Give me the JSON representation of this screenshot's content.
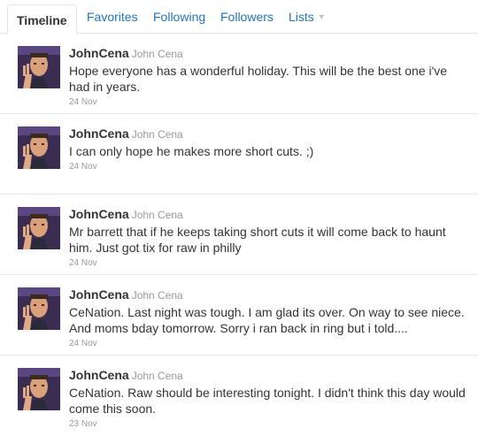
{
  "tabs": [
    {
      "label": "Timeline"
    },
    {
      "label": "Favorites"
    },
    {
      "label": "Following"
    },
    {
      "label": "Followers"
    },
    {
      "label": "Lists"
    }
  ],
  "tweets": [
    {
      "screen_name": "JohnCena",
      "full_name": "John Cena",
      "text": "Hope everyone has a wonderful holiday. This will be the best one i've had in years.",
      "time": "24 Nov"
    },
    {
      "screen_name": "JohnCena",
      "full_name": "John Cena",
      "text": "I can only hope he makes more short cuts. ;)",
      "time": "24 Nov"
    },
    {
      "screen_name": "JohnCena",
      "full_name": "John Cena",
      "text": "Mr barrett that if he keeps taking short cuts it will come back to haunt him. Just got tix for raw in philly",
      "time": "24 Nov"
    },
    {
      "screen_name": "JohnCena",
      "full_name": "John Cena",
      "text": "CeNation. Last night was tough. I am glad its over. On way to see niece. And moms bday tomorrow. Sorry i ran back in ring but i told....",
      "time": "24 Nov"
    },
    {
      "screen_name": "JohnCena",
      "full_name": "John Cena",
      "text": "CeNation. Raw should be interesting tonight. I didn't think this day would come this soon.",
      "time": "23 Nov"
    }
  ],
  "icons": {
    "lists_dropdown": "caret-down-icon"
  },
  "colors": {
    "link": "#2276bb",
    "text": "#333333",
    "muted": "#999999"
  }
}
